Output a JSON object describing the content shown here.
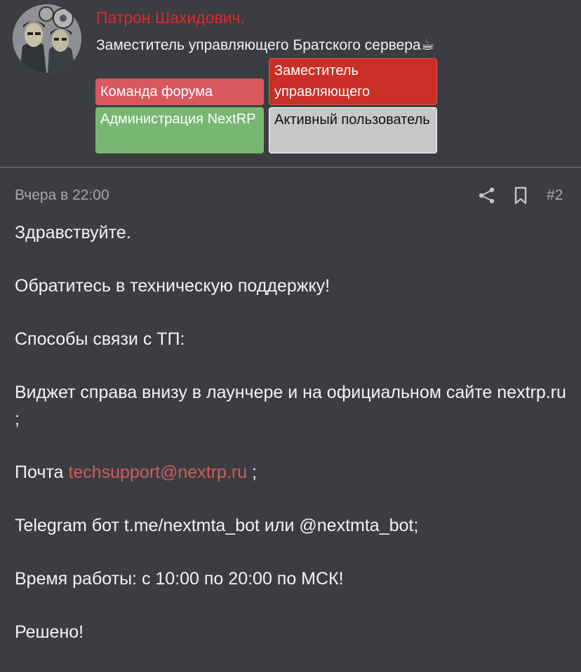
{
  "author": {
    "username": "Патрон Шахидович.",
    "user_title": "Заместитель управляющего Братского сервера",
    "title_emoji": "☕",
    "avatar_icon": "avatar-two-agents-icon"
  },
  "banners": {
    "team": "Команда форума",
    "deputy": "Заместитель управляющего",
    "admin": "Администрация NextRP",
    "active": "Активный пользователь"
  },
  "post": {
    "time": "Вчера в 22:00",
    "number": "#2",
    "share_icon": "share-icon",
    "bookmark_icon": "bookmark-icon"
  },
  "message": {
    "greeting": "Здравствуйте.",
    "line1": "Обратитесь в техническую поддержку!",
    "line2": "Способы связи с ТП:",
    "line3": "Виджет справа внизу в лаунчере и на официальном сайте nextrp.ru ;",
    "mail_prefix": "Почта",
    "mail_link": "techsupport@nextrp.ru",
    "mail_suffix": " ;",
    "line4": "Telegram бот t.me/nextmta_bot или @nextmta_bot;",
    "line5": "Время работы: с 10:00 по 20:00 по МСК!",
    "line6": "Решено!"
  },
  "colors": {
    "background": "#3b3d42",
    "username": "#e0282b",
    "team_banner": "#d9585e",
    "deputy_banner": "#c92f26",
    "admin_banner": "#78b773",
    "active_banner": "#c8c8c8",
    "link": "#d05c5e"
  }
}
